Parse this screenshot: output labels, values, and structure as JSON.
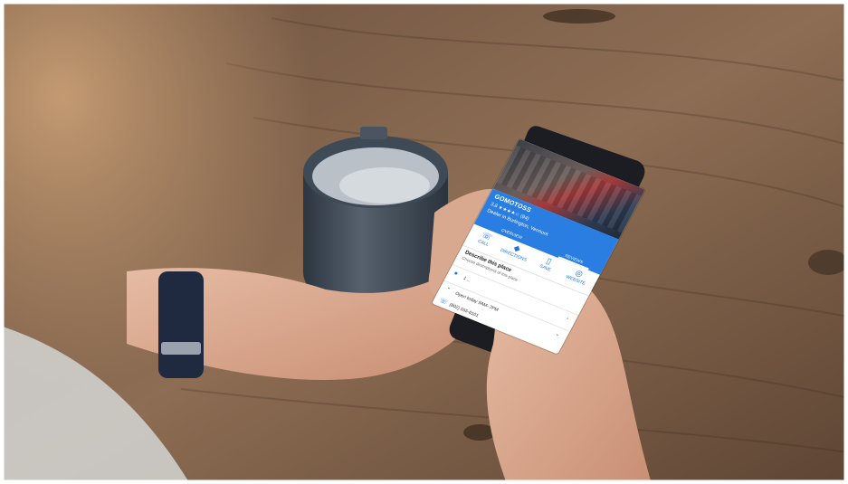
{
  "photo": {
    "description_icons": [
      "wood-table",
      "mug",
      "phone",
      "hands",
      "watch"
    ],
    "colors": {
      "wood_light": "#8a6a50",
      "wood_dark": "#4a3526",
      "mug": "#3f4a57",
      "mug_inner": "#b9c0c7",
      "skin": "#d9a98f",
      "watch": "#1f2a40",
      "phone": "#1b1d22",
      "sweater": "#c9c7c2",
      "hair": "#b58a62",
      "maps_blue": "#2a7de1"
    }
  },
  "screen": {
    "place": {
      "title": "GOMOTOSS",
      "rating": "3.8 ★★★★☆ (94)",
      "subtitle": "Dealer in Burlington, Vermont"
    },
    "tabs": [
      {
        "label": "OVERVIEW"
      },
      {
        "label": "REVIEWS"
      }
    ],
    "actions": [
      {
        "label": "CALL",
        "icon": "phone-icon",
        "glyph": "☏"
      },
      {
        "label": "DIRECTIONS",
        "icon": "directions-icon",
        "glyph": "◆"
      },
      {
        "label": "SAVE",
        "icon": "bookmark-icon",
        "glyph": "▯"
      },
      {
        "label": "WEBSITE",
        "icon": "globe-icon",
        "glyph": "◎"
      }
    ],
    "describe": {
      "heading": "Describe this place",
      "subtext": "Choose descriptions of this place"
    },
    "rows": [
      {
        "icon": "location-pin-icon",
        "glyph": "●",
        "text": "1 ..."
      },
      {
        "icon": "clock-icon",
        "glyph": "◔",
        "text": "Open today 9AM–7PM"
      },
      {
        "icon": "phone-icon",
        "glyph": "☏",
        "text": "(802) 555-0101"
      }
    ]
  }
}
